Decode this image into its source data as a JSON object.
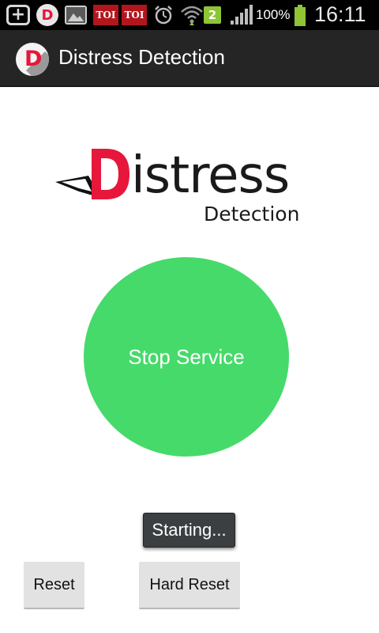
{
  "status_bar": {
    "icons": [
      "add-icon",
      "distress-app-notification-icon",
      "gallery-icon",
      "toi-icon",
      "toi-icon",
      "alarm-icon",
      "wifi-icon",
      "sim-icon",
      "signal-icon",
      "battery-icon"
    ],
    "toi_label": "TOI",
    "sim_label": "2",
    "battery_text": "100%",
    "time": "16:11"
  },
  "app_bar": {
    "title": "Distress Detection"
  },
  "brand": {
    "word": "istress",
    "subtitle": "Detection"
  },
  "main": {
    "stop_service_label": "Stop Service"
  },
  "toast": {
    "text": "Starting..."
  },
  "buttons": {
    "reset_label": "Reset",
    "hard_reset_label": "Hard Reset"
  },
  "colors": {
    "accent_red": "#e6173a",
    "button_green": "#46da6a",
    "app_bar": "#252525"
  }
}
